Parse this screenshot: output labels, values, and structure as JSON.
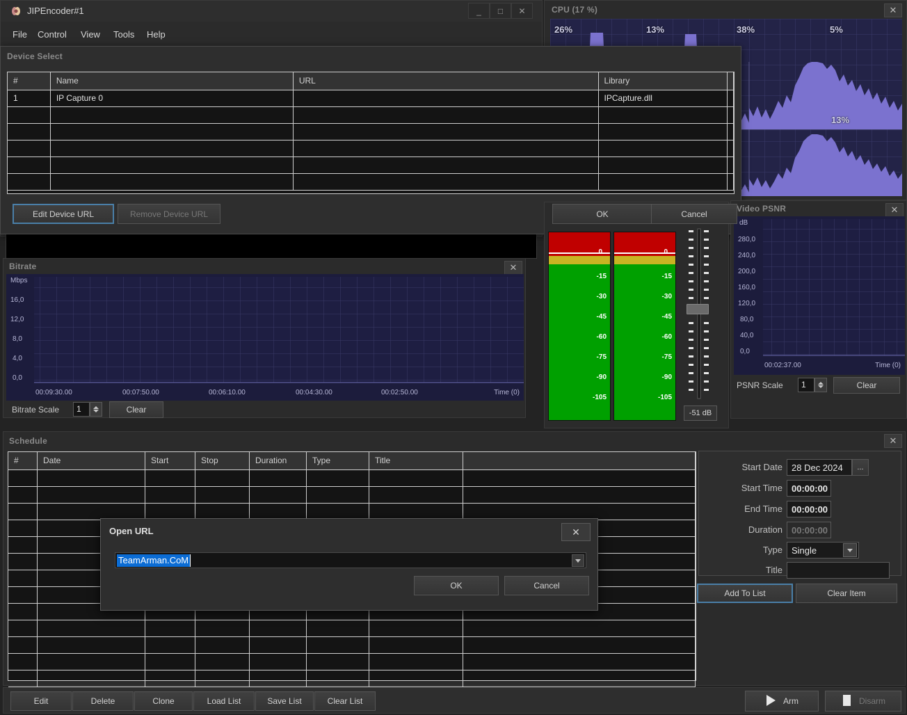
{
  "app": {
    "title": "JIPEncoder#1",
    "icon": "app-icon",
    "window_buttons": [
      {
        "name": "minimize",
        "glyph": "_"
      },
      {
        "name": "maximize",
        "glyph": "□"
      },
      {
        "name": "close",
        "glyph": "✕"
      }
    ],
    "menu": [
      "File",
      "Control",
      "View",
      "Tools",
      "Help"
    ]
  },
  "device_select": {
    "title": "Device Select",
    "columns": [
      "#",
      "Name",
      "URL",
      "Library",
      ""
    ],
    "rows": [
      {
        "num": "1",
        "name": "IP Capture 0",
        "url": "",
        "library": "IPCapture.dll"
      },
      {
        "num": "",
        "name": "",
        "url": "",
        "library": ""
      },
      {
        "num": "",
        "name": "",
        "url": "",
        "library": ""
      },
      {
        "num": "",
        "name": "",
        "url": "",
        "library": ""
      },
      {
        "num": "",
        "name": "",
        "url": "",
        "library": ""
      },
      {
        "num": "",
        "name": "",
        "url": "",
        "library": ""
      }
    ],
    "edit_button": "Edit Device URL",
    "remove_button": "Remove Device URL",
    "ok_button": "OK",
    "cancel_button": "Cancel"
  },
  "cpu": {
    "title": "CPU (17 %)",
    "close_glyph": "✕",
    "core_labels": [
      "26%",
      "13%",
      "38%",
      "5%",
      "13%"
    ],
    "graph_bg": "#232347",
    "trace_color": "#7b72cf"
  },
  "bitrate": {
    "title": "Bitrate",
    "close_glyph": "✕",
    "scale_label": "Bitrate Scale",
    "scale_value": "1",
    "clear_button": "Clear",
    "chart_data": {
      "type": "line",
      "title": "Bitrate",
      "ylabel": "Mbps",
      "xlabel": "Time (0)",
      "yticks": [
        "16,0",
        "12,0",
        "8,0",
        "4,0",
        "0,0"
      ],
      "ylim": [
        0,
        18
      ],
      "xticks": [
        "00:09:30.00",
        "00:07:50.00",
        "00:06:10.00",
        "00:04:30.00",
        "00:02:50.00"
      ],
      "series": [
        {
          "name": "bitrate",
          "values": []
        }
      ],
      "grid": true,
      "legend": "none"
    }
  },
  "audio": {
    "ticks": [
      "-15",
      "-30",
      "-45",
      "-60",
      "-75",
      "-90",
      "-105"
    ],
    "zero_label": "0",
    "db_value": "-51 dB",
    "left_channel": "audio-meter-left",
    "right_channel": "audio-meter-right"
  },
  "psnr": {
    "title": "Video PSNR",
    "close_glyph": "✕",
    "scale_label": "PSNR Scale",
    "scale_value": "1",
    "clear_button": "Clear",
    "chart_data": {
      "type": "line",
      "title": "Video PSNR",
      "ylabel": "dB",
      "xlabel": "Time (0)",
      "yticks": [
        "280,0",
        "240,0",
        "200,0",
        "160,0",
        "120,0",
        "80,0",
        "40,0",
        "0,0"
      ],
      "ylim": [
        0,
        300
      ],
      "xticks": [
        "00:02:37.00"
      ],
      "series": [
        {
          "name": "psnr",
          "values": []
        }
      ],
      "grid": true,
      "legend": "none"
    }
  },
  "schedule": {
    "title": "Schedule",
    "close_glyph": "✕",
    "columns": [
      "#",
      "Date",
      "Start",
      "Stop",
      "Duration",
      "Type",
      "Title",
      ""
    ],
    "row_count": 13,
    "form": {
      "start_date_label": "Start Date",
      "start_date_value": "28 Dec 2024",
      "browse_button": "...",
      "start_time_label": "Start Time",
      "start_time_value": "00:00:00",
      "end_time_label": "End Time",
      "end_time_value": "00:00:00",
      "duration_label": "Duration",
      "duration_value": "00:00:00",
      "type_label": "Type",
      "type_value": "Single",
      "title_label": "Title",
      "title_value": "",
      "add_button": "Add To List",
      "clear_button": "Clear Item"
    }
  },
  "bottom_bar": {
    "buttons": [
      "Edit",
      "Delete",
      "Clone",
      "Load List",
      "Save List",
      "Clear List"
    ],
    "arm_label": "Arm",
    "disarm_label": "Disarm"
  },
  "open_url_dialog": {
    "title": "Open URL",
    "close_glyph": "✕",
    "url_value": "TeamArman.CoM",
    "url_placeholder": "",
    "ok_button": "OK",
    "cancel_button": "Cancel"
  }
}
